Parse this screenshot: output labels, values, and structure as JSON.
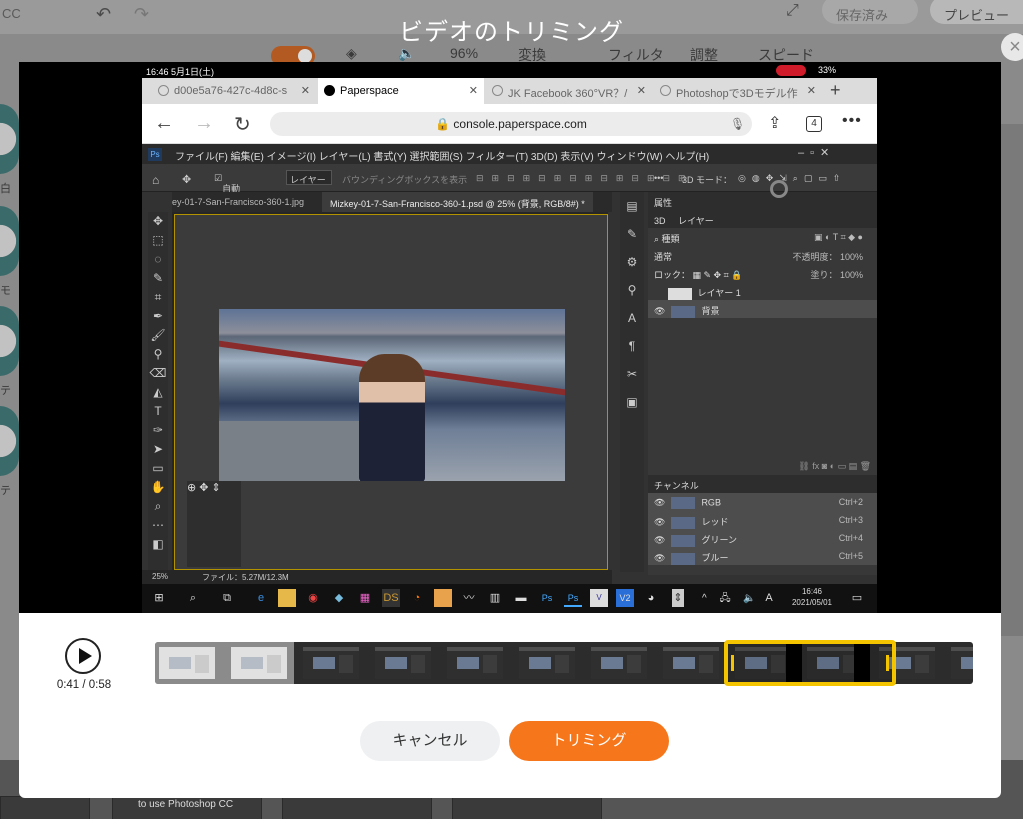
{
  "background": {
    "brand_fragment": "CC",
    "saved_label": "保存済み",
    "preview_label": "プレビュー",
    "toolbar": {
      "zoom": "96%",
      "convert": "変換",
      "filter": "フィルタ",
      "adjust": "調整",
      "speed": "スピード"
    },
    "left_labels": [
      "白",
      "モ",
      "テ",
      "テ"
    ],
    "bottom_caption": "to use Photoshop CC"
  },
  "modal": {
    "title": "ビデオのトリミング",
    "close_glyph": "×"
  },
  "video": {
    "status": {
      "time": "16:46 5月1日(土)",
      "battery": "33%"
    },
    "tabs": [
      {
        "label": "d00e5a76-427c-4d8c-s",
        "active": false
      },
      {
        "label": "Paperspace",
        "active": true
      },
      {
        "label": "JK Facebook 360°VR？/",
        "active": false
      },
      {
        "label": "Photoshopで3Dモデル作",
        "active": false
      }
    ],
    "url": "console.paperspace.com",
    "tab_count": "4",
    "photoshop": {
      "menu": "ファイル(F)  編集(E)  イメージ(I)  レイヤー(L)  書式(Y)  選択範囲(S)  フィルター(T)  3D(D)  表示(V)  ウィンドウ(W)  ヘルプ(H)",
      "auto_select": "自動選択：",
      "layer_dropdown": "レイヤー",
      "bbox_label": "バウンディングボックスを表示",
      "mode_3d": "3D モード：",
      "doc_tab_1": "ey-01-7-San-Francisco-360-1.jpg",
      "doc_tab_2": "Mizkey-01-7-San-Francisco-360-1.psd @ 25% (背景, RGB/8#) *",
      "zoom": "25%",
      "file_size": "ファイル：5.27M/12.3M",
      "props_title": "属性",
      "panel_tabs": [
        "3D",
        "レイヤー"
      ],
      "kind_label": "種類",
      "blend_mode": "通常",
      "opacity_label": "不透明度：",
      "opacity_value": "100%",
      "lock_label": "ロック：",
      "fill_label": "塗り：",
      "fill_value": "100%",
      "layers": [
        "レイヤー 1",
        "背景"
      ],
      "channels_title": "チャンネル",
      "channels": [
        {
          "name": "RGB",
          "shortcut": "Ctrl+2"
        },
        {
          "name": "レッド",
          "shortcut": "Ctrl+3"
        },
        {
          "name": "グリーン",
          "shortcut": "Ctrl+4"
        },
        {
          "name": "ブルー",
          "shortcut": "Ctrl+5"
        }
      ]
    },
    "taskbar": {
      "time": "16:46",
      "date": "2021/05/01",
      "ime": "A"
    }
  },
  "trim": {
    "timecode": "0:41 / 0:58",
    "progress_fraction": 0.707,
    "selection_start_fraction": 0.7,
    "selection_end_fraction": 0.9,
    "accent_color": "#f5c400",
    "cancel_label": "キャンセル",
    "trim_label": "トリミング",
    "trim_color": "#f6761b"
  }
}
